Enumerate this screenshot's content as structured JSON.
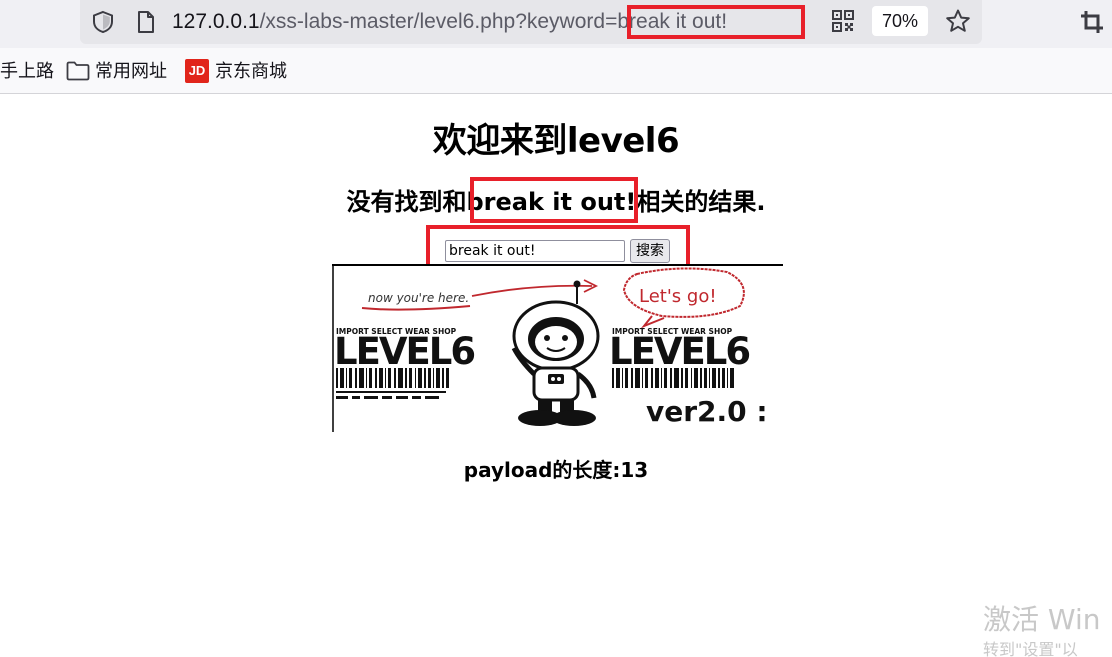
{
  "browser": {
    "url_host": "127.0.0.1",
    "url_path": "/xss-labs-master/level6.php?keyword",
    "url_query": "=break it out!",
    "zoom": "70%"
  },
  "bookmarks": [
    {
      "label": "手上路",
      "icon": "none"
    },
    {
      "label": "常用网址",
      "icon": "folder-icon"
    },
    {
      "label": "京东商城",
      "icon": "jd-icon",
      "icon_text": "JD"
    }
  ],
  "page": {
    "title": "欢迎来到level6",
    "result_prefix": "没有找到和",
    "result_keyword": "break it out!",
    "result_suffix": "相关的结果.",
    "search_value": "break it out!",
    "search_button": "搜索",
    "payload_length": "payload的长度:13"
  },
  "banner": {
    "tagline": "now you're here.",
    "speech": "Let's go!",
    "shop_label_left": "IMPORT SELECT WEAR SHOP",
    "shop_label_right": "IMPORT SELECT WEAR SHOP",
    "level_left": "LEVEL6",
    "level_right": "LEVEL6",
    "version": "ver2.0 :"
  },
  "watermark": {
    "line1": "激活 Win",
    "line2": "转到\"设置\"以"
  },
  "colors": {
    "highlight": "#e8202a",
    "accent_red": "#c0282e",
    "jd_red": "#e1251b"
  }
}
